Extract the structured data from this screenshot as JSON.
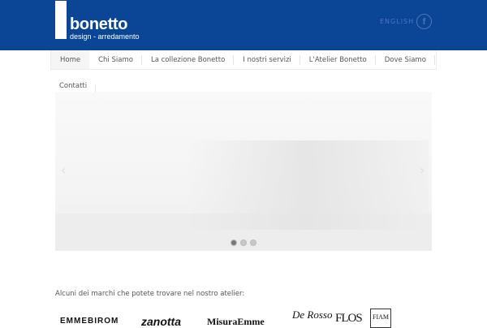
{
  "header": {
    "logo_name": "bonetto",
    "logo_sub": "design - arredamento",
    "language": "ENGLISH",
    "social_icon": "facebook-icon",
    "bg_color": "#0b4596"
  },
  "nav": {
    "items": [
      {
        "label": "Home",
        "active": true
      },
      {
        "label": "Chi Siamo"
      },
      {
        "label": "La collezione Bonetto"
      },
      {
        "label": "I nostri servizi"
      },
      {
        "label": "L'Atelier Bonetto"
      },
      {
        "label": "Dove Siamo"
      },
      {
        "label": "Contatti"
      }
    ]
  },
  "slider": {
    "slides": 3,
    "active_slide": 1,
    "prev_icon": "chevron-left-icon",
    "next_icon": "chevron-right-icon"
  },
  "brands": {
    "label": "Alcuni dei marchi che potete trovare nel nostro atelier:",
    "items": [
      "EMMEBIROM",
      "zanotta",
      "MisuraEmme",
      "De Rosso",
      "FLOS",
      "FIAM"
    ]
  }
}
